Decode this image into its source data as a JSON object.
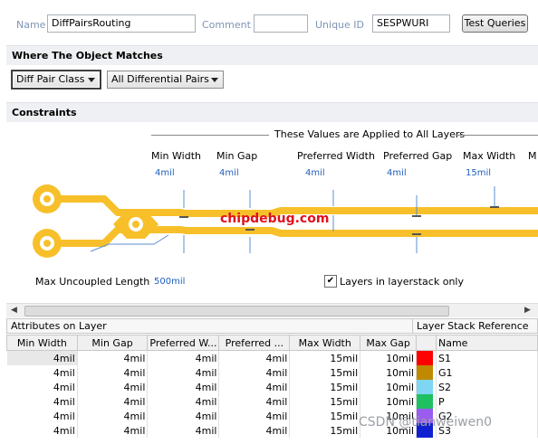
{
  "top": {
    "name_label": "Name",
    "name_value": "DiffPairsRouting",
    "comment_label": "Comment",
    "comment_value": "",
    "uid_label": "Unique ID",
    "uid_value": "SESPWURI",
    "test_button": "Test Queries"
  },
  "where": {
    "title": "Where The Object Matches",
    "select1": "Diff Pair Class",
    "select2": "All Differential Pairs"
  },
  "constraints": {
    "title": "Constraints",
    "applied_note": "These Values are Applied to All Layers",
    "columns": [
      {
        "label": "Min Width",
        "value": "4mil"
      },
      {
        "label": "Min Gap",
        "value": "4mil"
      },
      {
        "label": "Preferred Width",
        "value": "4mil"
      },
      {
        "label": "Preferred Gap",
        "value": "4mil"
      },
      {
        "label": "Max Width",
        "value": "15mil"
      },
      {
        "label": "M",
        "value": ""
      }
    ],
    "watermark": "chipdebug.com",
    "uncoupled_label": "Max Uncoupled Length",
    "uncoupled_value": "500mil",
    "layers_only_label": "Layers in layerstack only",
    "layers_only_checked": true,
    "trace_color": "#f7c02a"
  },
  "table": {
    "group_left": "Attributes on Layer",
    "group_right": "Layer Stack Reference",
    "headers": [
      "Min Width",
      "Min Gap",
      "Preferred W...",
      "Preferred ...",
      "Max Width",
      "Max Gap",
      "",
      "Name"
    ],
    "rows": [
      {
        "cells": [
          "4mil",
          "4mil",
          "4mil",
          "4mil",
          "15mil",
          "10mil"
        ],
        "color": "#ff0000",
        "name": "S1"
      },
      {
        "cells": [
          "4mil",
          "4mil",
          "4mil",
          "4mil",
          "15mil",
          "10mil"
        ],
        "color": "#c08a00",
        "name": "G1"
      },
      {
        "cells": [
          "4mil",
          "4mil",
          "4mil",
          "4mil",
          "15mil",
          "10mil"
        ],
        "color": "#7ed6f2",
        "name": "S2"
      },
      {
        "cells": [
          "4mil",
          "4mil",
          "4mil",
          "4mil",
          "15mil",
          "10mil"
        ],
        "color": "#1fc060",
        "name": "P"
      },
      {
        "cells": [
          "4mil",
          "4mil",
          "4mil",
          "4mil",
          "15mil",
          "10mil"
        ],
        "color": "#9b5cf0",
        "name": "G2"
      },
      {
        "cells": [
          "4mil",
          "4mil",
          "4mil",
          "4mil",
          "15mil",
          "10mil"
        ],
        "color": "#1020d0",
        "name": "S3"
      }
    ]
  },
  "footer_watermark": "CSDN @tianweiwen0"
}
